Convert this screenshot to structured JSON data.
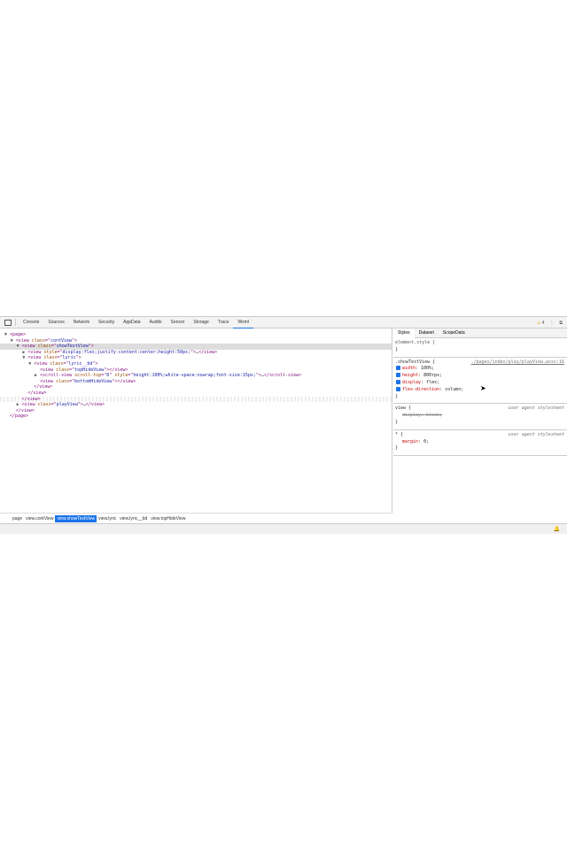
{
  "toolbar": {
    "tabs": [
      "Console",
      "Sources",
      "Network",
      "Security",
      "AppData",
      "Audits",
      "Sensor",
      "Storage",
      "Trace",
      "Wxml"
    ],
    "active": "Wxml",
    "warnings": "4"
  },
  "tree": [
    {
      "i": 0,
      "a": "▼",
      "s": [
        [
          "t",
          "<page>"
        ]
      ]
    },
    {
      "i": 1,
      "a": "▼",
      "s": [
        [
          "t",
          "<view "
        ],
        [
          "an",
          "class"
        ],
        [
          "t",
          "=\""
        ],
        [
          "av",
          "contView"
        ],
        [
          "t",
          "\">"
        ]
      ]
    },
    {
      "i": 2,
      "a": "▼",
      "sel": true,
      "s": [
        [
          "t",
          "<view "
        ],
        [
          "an",
          "class"
        ],
        [
          "t",
          "=\""
        ],
        [
          "av",
          "showTextView"
        ],
        [
          "t",
          "\">"
        ]
      ]
    },
    {
      "i": 3,
      "a": "▶",
      "s": [
        [
          "t",
          "<view "
        ],
        [
          "an",
          "style"
        ],
        [
          "t",
          "=\""
        ],
        [
          "av",
          "display:flex;justify-content:center;height:50px;"
        ],
        [
          "t",
          "\">"
        ],
        [
          "tx",
          "…"
        ],
        [
          "t",
          "</view>"
        ]
      ]
    },
    {
      "i": 3,
      "a": "▼",
      "s": [
        [
          "t",
          "<view "
        ],
        [
          "an",
          "class"
        ],
        [
          "t",
          "=\""
        ],
        [
          "av",
          "lyric"
        ],
        [
          "t",
          "\">"
        ]
      ]
    },
    {
      "i": 4,
      "a": "▼",
      "s": [
        [
          "t",
          "<view "
        ],
        [
          "an",
          "class"
        ],
        [
          "t",
          "=\""
        ],
        [
          "av",
          "lyric__bd"
        ],
        [
          "t",
          "\">"
        ]
      ]
    },
    {
      "i": 5,
      "a": "",
      "s": [
        [
          "t",
          "<view "
        ],
        [
          "an",
          "class"
        ],
        [
          "t",
          "=\""
        ],
        [
          "av",
          "topHideView"
        ],
        [
          "t",
          "\"></view>"
        ]
      ]
    },
    {
      "i": 5,
      "a": "▶",
      "s": [
        [
          "t",
          "<scroll-view "
        ],
        [
          "an",
          "scroll-top"
        ],
        [
          "t",
          "=\""
        ],
        [
          "av",
          "0"
        ],
        [
          "t",
          "\" "
        ],
        [
          "an",
          "style"
        ],
        [
          "t",
          "=\""
        ],
        [
          "av",
          "height:100%;white-space:nowrap;font-size:15px;"
        ],
        [
          "t",
          "\">"
        ],
        [
          "tx",
          "…"
        ],
        [
          "t",
          "</scroll-view>"
        ]
      ]
    },
    {
      "i": 5,
      "a": "",
      "s": [
        [
          "t",
          "<view "
        ],
        [
          "an",
          "class"
        ],
        [
          "t",
          "=\""
        ],
        [
          "av",
          "bottomHideView"
        ],
        [
          "t",
          "\"></view>"
        ]
      ]
    },
    {
      "i": 4,
      "a": "",
      "s": [
        [
          "t",
          "</view>"
        ]
      ]
    },
    {
      "i": 3,
      "a": "",
      "s": [
        [
          "t",
          "</view>"
        ]
      ]
    },
    {
      "i": 2,
      "a": "",
      "hov": true,
      "s": [
        [
          "t",
          "</view>"
        ]
      ]
    },
    {
      "i": 2,
      "a": "▶",
      "s": [
        [
          "t",
          "<view "
        ],
        [
          "an",
          "class"
        ],
        [
          "t",
          "=\""
        ],
        [
          "av",
          "playView"
        ],
        [
          "t",
          "\">"
        ],
        [
          "tx",
          "…"
        ],
        [
          "t",
          "</view>"
        ]
      ]
    },
    {
      "i": 1,
      "a": "",
      "s": [
        [
          "t",
          "</view>"
        ]
      ]
    },
    {
      "i": 0,
      "a": "",
      "s": [
        [
          "t",
          "</page>"
        ]
      ]
    }
  ],
  "styles": {
    "tabs": [
      "Styles",
      "Dataset",
      "ScopeData"
    ],
    "element_style": "element.style {",
    "close": "}",
    "rule1": {
      "selector": ".showTextView {",
      "source": "./pages/index/play/playView.wxss:16",
      "props": [
        [
          "width",
          "100%;"
        ],
        [
          "height",
          "800rpx;"
        ],
        [
          "display",
          "flex;"
        ],
        [
          "flex-direction",
          "column;"
        ]
      ]
    },
    "rule2": {
      "selector": "view {",
      "source": "user agent stylesheet",
      "prop": "display: block;"
    },
    "rule3": {
      "selector": "* {",
      "source": "user agent stylesheet",
      "name": "margin",
      "value": "0;"
    }
  },
  "breadcrumbs": [
    "page",
    "view.contView",
    "view.showTextView",
    "view.lyric",
    "view.lyric__bd",
    "view.topHideView"
  ],
  "breadcrumb_active": 2
}
